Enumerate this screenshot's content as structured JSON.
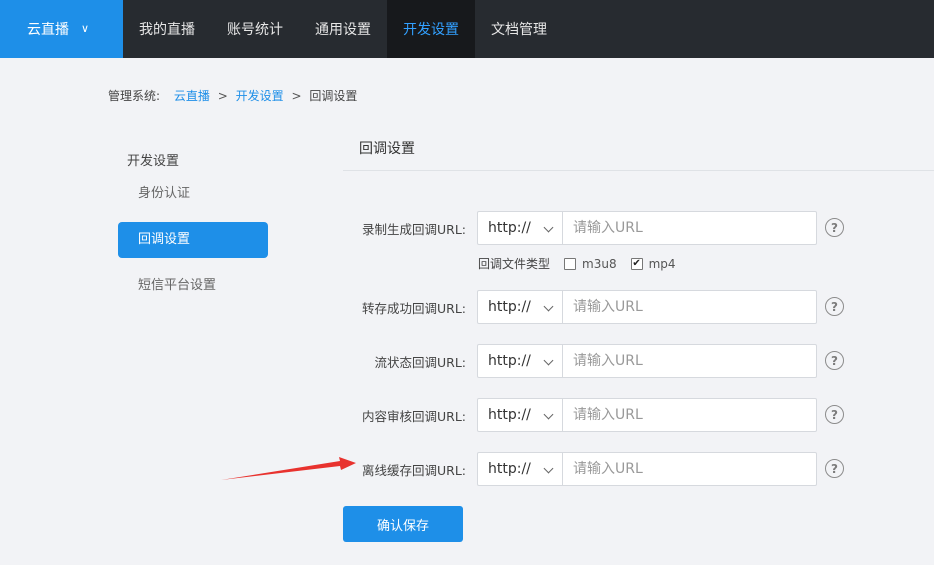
{
  "topnav": {
    "brand": "云直播",
    "brand_chevron": "∨",
    "items": [
      {
        "label": "我的直播"
      },
      {
        "label": "账号统计"
      },
      {
        "label": "通用设置"
      },
      {
        "label": "开发设置",
        "active": true
      },
      {
        "label": "文档管理"
      }
    ]
  },
  "breadcrumb": {
    "prefix": "管理系统:",
    "crumbs": [
      "云直播",
      "开发设置",
      "回调设置"
    ],
    "separator": ">"
  },
  "sidebar": {
    "title": "开发设置",
    "items": [
      {
        "label": "身份认证"
      },
      {
        "label": "回调设置",
        "active": true
      },
      {
        "label": "短信平台设置"
      }
    ]
  },
  "main": {
    "title": "回调设置",
    "rows": [
      {
        "label": "录制生成回调URL:",
        "protocol": "http://",
        "placeholder": "请输入URL"
      },
      {
        "label": "转存成功回调URL:",
        "protocol": "http://",
        "placeholder": "请输入URL"
      },
      {
        "label": "流状态回调URL:",
        "protocol": "http://",
        "placeholder": "请输入URL"
      },
      {
        "label": "内容审核回调URL:",
        "protocol": "http://",
        "placeholder": "请输入URL"
      },
      {
        "label": "离线缓存回调URL:",
        "protocol": "http://",
        "placeholder": "请输入URL"
      }
    ],
    "file_type": {
      "label": "回调文件类型",
      "options": [
        {
          "label": "m3u8",
          "checked": false
        },
        {
          "label": "mp4",
          "checked": true
        }
      ]
    },
    "help_glyph": "?",
    "save_label": "确认保存"
  },
  "colors": {
    "accent": "#1e8fe8",
    "nav_bg": "#272b30",
    "annotation_arrow": "#e8322e"
  },
  "icons": {
    "help": "question-circle-icon",
    "dropdown": "chevron-down-icon",
    "annotation": "red-arrow-annotation"
  }
}
